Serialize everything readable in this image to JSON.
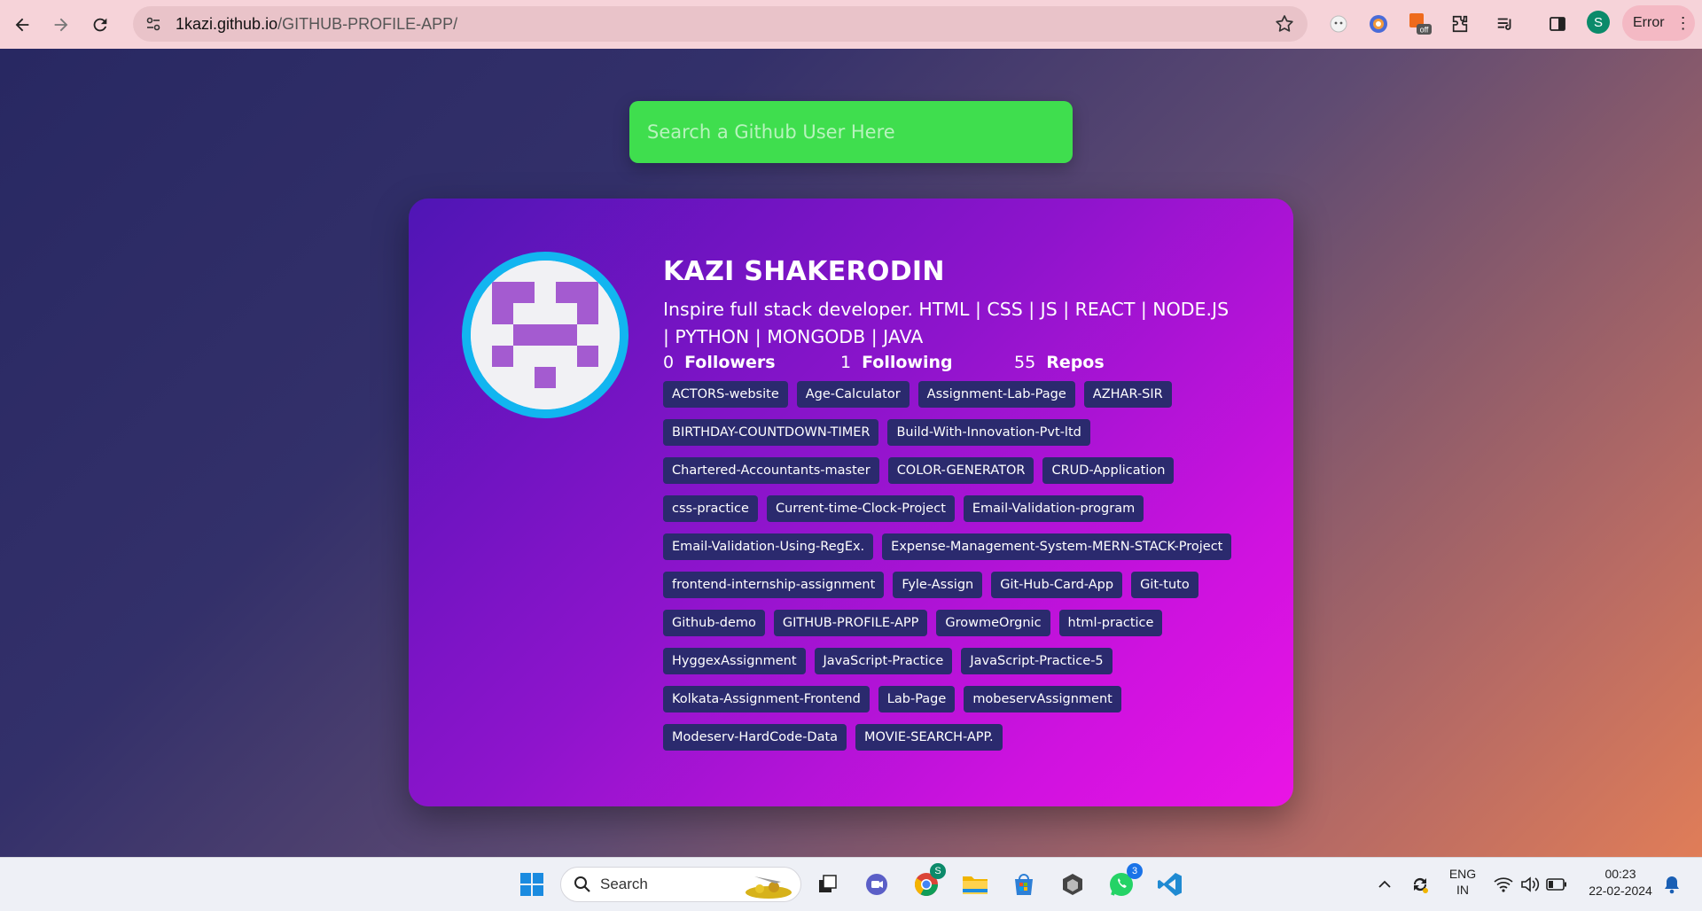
{
  "browser": {
    "url_host": "1kazi.github.io",
    "url_path": "/GITHUB-PROFILE-APP/",
    "profile_initial": "S",
    "error_label": "Error",
    "menu_glyph": "⋮"
  },
  "search": {
    "placeholder": "Search a Github User Here",
    "accent": "#3fde4e"
  },
  "profile": {
    "name": "KAZI SHAKERODIN",
    "bio": "Inspire full stack developer. HTML | CSS | JS | REACT | NODE.JS | PYTHON | MONGODB | JAVA",
    "followers_count": "0",
    "followers_label": "Followers",
    "following_count": "1",
    "following_label": "Following",
    "repos_count": "55",
    "repos_label": "Repos",
    "repos": [
      "ACTORS-website",
      "Age-Calculator",
      "Assignment-Lab-Page",
      "AZHAR-SIR",
      "BIRTHDAY-COUNTDOWN-TIMER",
      "Build-With-Innovation-Pvt-ltd",
      "Chartered-Accountants-master",
      "COLOR-GENERATOR",
      "CRUD-Application",
      "css-practice",
      "Current-time-Clock-Project",
      "Email-Validation-program",
      "Email-Validation-Using-RegEx.",
      "Expense-Management-System-MERN-STACK-Project",
      "frontend-internship-assignment",
      "Fyle-Assign",
      "Git-Hub-Card-App",
      "Git-tuto",
      "Github-demo",
      "GITHUB-PROFILE-APP",
      "GrowmeOrgnic",
      "html-practice",
      "HyggexAssignment",
      "JavaScript-Practice",
      "JavaScript-Practice-5",
      "Kolkata-Assignment-Frontend",
      "Lab-Page",
      "mobeservAssignment",
      "Modeserv-HardCode-Data",
      "MOVIE-SEARCH-APP."
    ]
  },
  "taskbar": {
    "search_label": "Search",
    "chrome_badge": "S",
    "whatsapp_badge": "3",
    "lang_line1": "ENG",
    "lang_line2": "IN",
    "time": "00:23",
    "date": "22-02-2024"
  },
  "colors": {
    "card_gradient_start": "#4f15b5",
    "card_gradient_end": "#ea14e5",
    "repo_chip": "#2b2a6e",
    "avatar_ring": "#12b5f0"
  }
}
